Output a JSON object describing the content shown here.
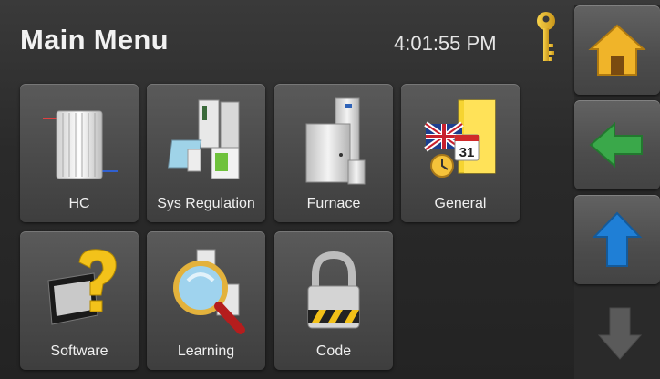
{
  "header": {
    "title": "Main Menu",
    "time": "4:01:55 PM",
    "key_icon": "key-icon"
  },
  "tiles": [
    {
      "label": "HC",
      "icon": "radiator-icon"
    },
    {
      "label": "Sys Regulation",
      "icon": "system-regulation-icon"
    },
    {
      "label": "Furnace",
      "icon": "furnace-icon"
    },
    {
      "label": "General",
      "icon": "general-calendar-flag-icon"
    },
    {
      "label": "Software",
      "icon": "software-question-icon"
    },
    {
      "label": "Learning",
      "icon": "magnifier-icon"
    },
    {
      "label": "Code",
      "icon": "padlock-icon"
    }
  ],
  "side_nav": [
    {
      "icon": "home-icon",
      "color": "#f0b429"
    },
    {
      "icon": "back-arrow-icon",
      "color": "#3aa84a"
    },
    {
      "icon": "up-arrow-icon",
      "color": "#1f7fd6"
    },
    {
      "icon": "down-arrow-icon",
      "color": "#5a5a5a"
    }
  ]
}
